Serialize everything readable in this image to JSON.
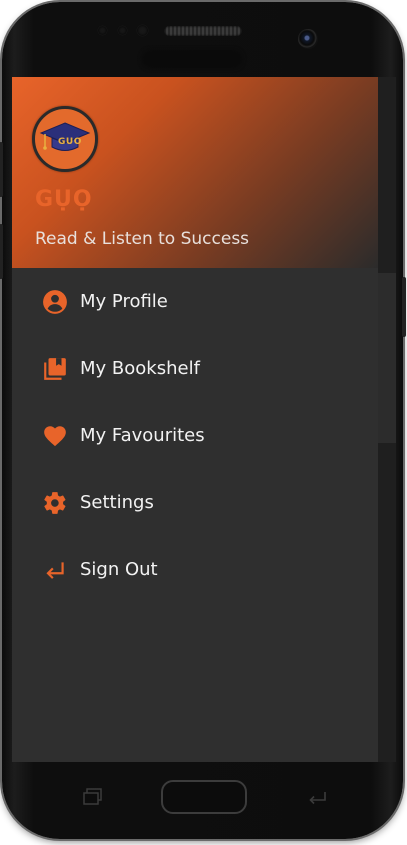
{
  "header": {
    "logo_text": "GUO",
    "app_name": "GỤỌ",
    "tagline": "Read & Listen to Success"
  },
  "menu": {
    "items": [
      {
        "label": "My Profile",
        "icon": "account-circle-icon"
      },
      {
        "label": "My Bookshelf",
        "icon": "bookshelf-icon"
      },
      {
        "label": "My Favourites",
        "icon": "heart-icon"
      },
      {
        "label": "Settings",
        "icon": "gear-icon"
      },
      {
        "label": "Sign Out",
        "icon": "sign-out-arrow-icon"
      }
    ]
  },
  "colors": {
    "accent": "#e8642a",
    "drawer_background": "#2f2f2f",
    "menu_text": "#f2f2f2"
  }
}
